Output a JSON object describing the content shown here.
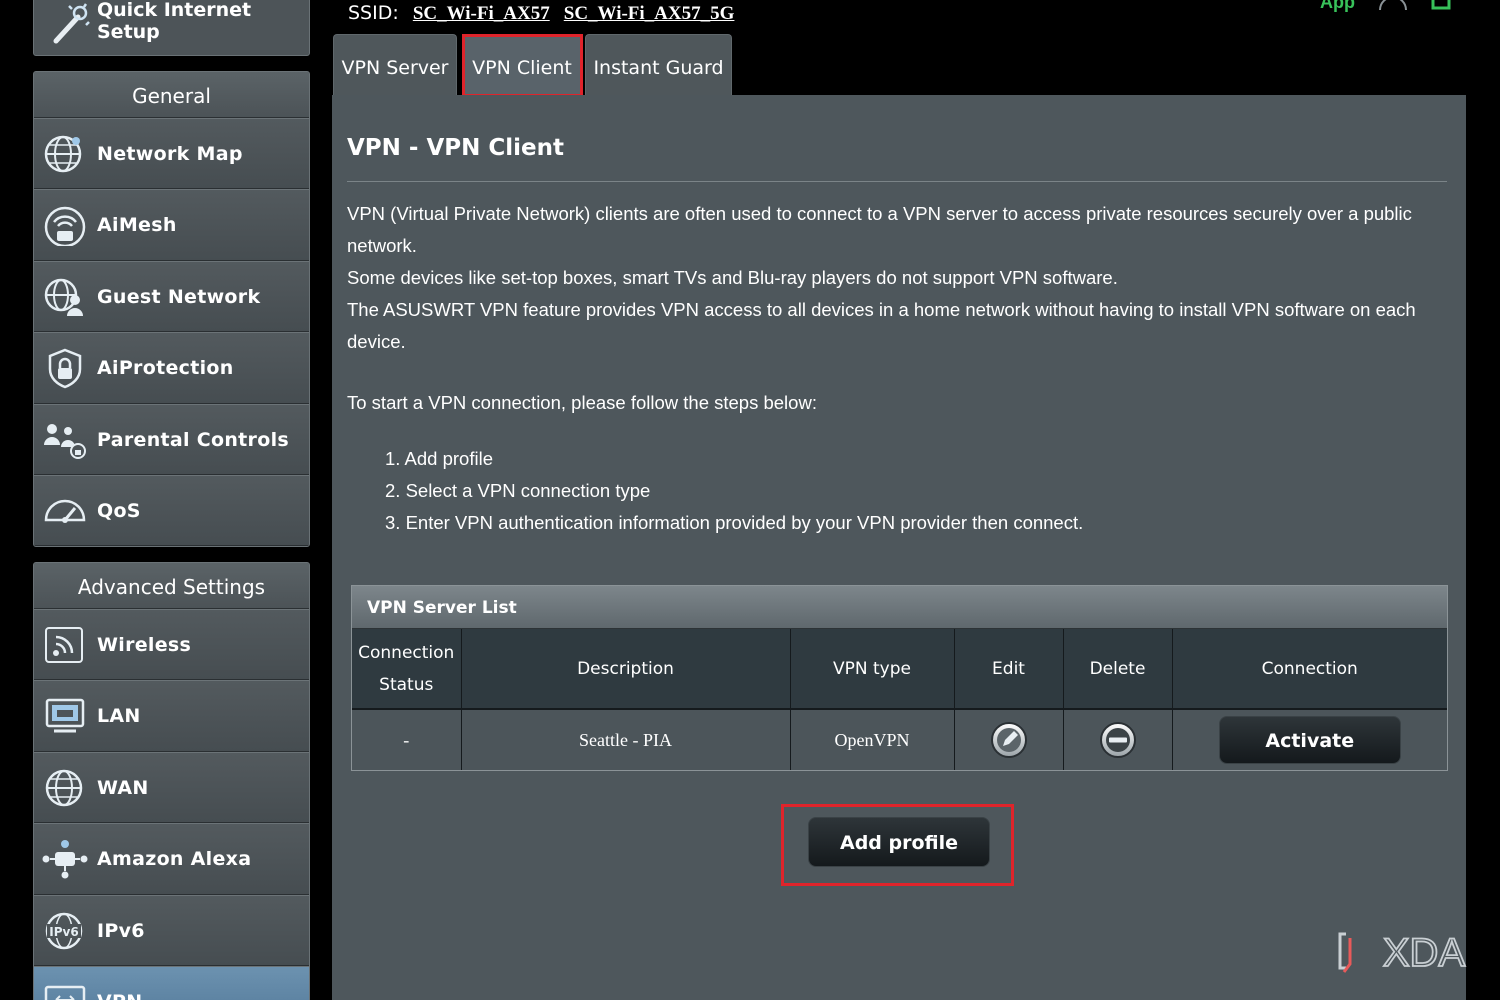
{
  "sidebar": {
    "quick_setup_label": "Quick Internet\nSetup",
    "general": {
      "title": "General",
      "items": [
        {
          "label": "Network Map",
          "icon": "globe-network-icon"
        },
        {
          "label": "AiMesh",
          "icon": "aimesh-router-icon"
        },
        {
          "label": "Guest Network",
          "icon": "guest-network-icon"
        },
        {
          "label": "AiProtection",
          "icon": "shield-lock-icon"
        },
        {
          "label": "Parental Controls",
          "icon": "family-lock-icon"
        },
        {
          "label": "QoS",
          "icon": "gauge-icon"
        }
      ]
    },
    "advanced": {
      "title": "Advanced Settings",
      "items": [
        {
          "label": "Wireless",
          "icon": "wireless-icon"
        },
        {
          "label": "LAN",
          "icon": "lan-monitor-icon"
        },
        {
          "label": "WAN",
          "icon": "wan-globe-icon"
        },
        {
          "label": "Amazon Alexa",
          "icon": "alexa-router-icon"
        },
        {
          "label": "IPv6",
          "icon": "ipv6-globe-icon"
        },
        {
          "label": "VPN",
          "icon": "vpn-icon",
          "active": true
        }
      ]
    }
  },
  "header": {
    "ssid_label": "SSID:",
    "ssid_values": [
      "SC_Wi-Fi_AX57",
      "SC_Wi-Fi_AX57_5G"
    ],
    "app_label": "App"
  },
  "tabs": [
    {
      "label": "VPN Server"
    },
    {
      "label": "VPN Client",
      "selected": true
    },
    {
      "label": "Instant Guard"
    }
  ],
  "main": {
    "title": "VPN - VPN Client",
    "description": [
      "VPN (Virtual Private Network) clients are often used to connect to a VPN server to access private resources securely over a public network.",
      "Some devices like set-top boxes, smart TVs and Blu-ray players do not support VPN software.",
      "The ASUSWRT VPN feature provides VPN access to all devices in a home network without having to install VPN software on each device."
    ],
    "intro": "To start a VPN connection, please follow the steps below:",
    "steps": [
      "1. Add profile",
      "2. Select a VPN connection type",
      "3. Enter VPN authentication information provided by your VPN provider then connect."
    ],
    "server_list": {
      "title": "VPN Server List",
      "columns": [
        "Connection Status",
        "Description",
        "VPN type",
        "Edit",
        "Delete",
        "Connection"
      ],
      "rows": [
        {
          "status": "-",
          "description": "Seattle - PIA",
          "vpn_type": "OpenVPN",
          "action": "Activate"
        }
      ]
    },
    "add_profile_label": "Add profile"
  },
  "watermark": "XDA",
  "colors": {
    "panel_bg": "#4e575c",
    "highlight_red": "#e0242b",
    "app_green": "#38c25a",
    "active_menu": "#5f86a6"
  }
}
